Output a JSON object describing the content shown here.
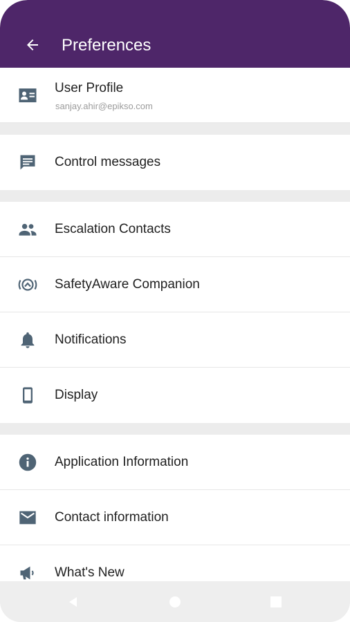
{
  "header": {
    "title": "Preferences",
    "back_icon": "arrow-back-icon"
  },
  "theme": {
    "appbar_color": "#4e2669",
    "icon_color": "#4f6475"
  },
  "profile": {
    "label": "User Profile",
    "email": "sanjay.ahir@epikso.com",
    "icon": "account-card-icon"
  },
  "items": [
    {
      "label": "Control messages",
      "icon": "message-icon"
    },
    {
      "label": "Escalation Contacts",
      "icon": "people-icon"
    },
    {
      "label": "SafetyAware Companion",
      "icon": "companion-signal-icon"
    },
    {
      "label": "Notifications",
      "icon": "bell-icon"
    },
    {
      "label": "Display",
      "icon": "phone-display-icon"
    },
    {
      "label": "Application Information",
      "icon": "info-icon"
    },
    {
      "label": "Contact information",
      "icon": "mail-icon"
    },
    {
      "label": "What's New",
      "icon": "megaphone-icon"
    }
  ],
  "navbar": {
    "back": "nav-back-icon",
    "home": "nav-home-icon",
    "recents": "nav-recents-icon"
  }
}
